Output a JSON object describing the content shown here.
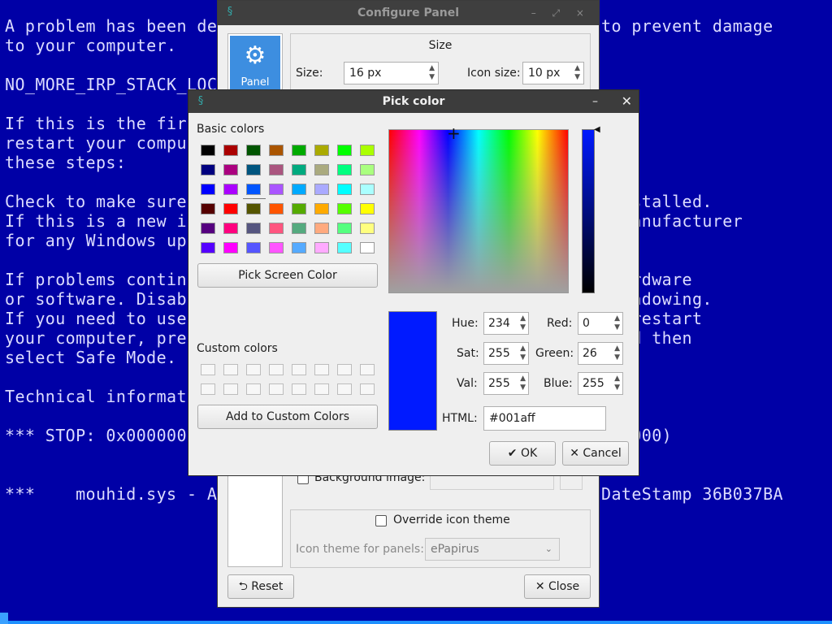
{
  "bsod": {
    "text": "A problem has been detected and Windows has been shut down to prevent damage\nto your computer.\n\nNO_MORE_IRP_STACK_LOCATIONS\n\nIf this is the first time you've seen this stop error screen,\nrestart your computer. If this screen appears again, follow\nthese steps:\n\nCheck to make sure any new hardware or software is properly installed.\nIf this is a new installation, ask your hardware or software manufacturer\nfor any Windows updates you might need.\n\nIf problems continue, disable or remove any newly installed hardware\nor software. Disable BIOS memory options such as caching or shadowing.\nIf you need to use Safe Mode to remove or disable components, restart\nyour computer, press F8 to select Advanced Startup Options, and then\nselect Safe Mode.\n\nTechnical information:\n\n*** STOP: 0x00000035 (0x00000000,0x00000000,0x00000000,0x00000000)\n\n\n***    mouhid.sys - Address 0xF84A6000 base at 0xF84A4000, DateStamp 36B037BA"
  },
  "config_panel": {
    "title": "Configure Panel",
    "side_item_label": "Panel",
    "size_group_title": "Size",
    "size_label": "Size:",
    "size_value": "16 px",
    "icon_size_label": "Icon size:",
    "icon_size_value": "10 px",
    "background_image_label": "Background image:",
    "override_icon_theme_label": "Override icon theme",
    "icon_theme_label": "Icon theme for panels:",
    "icon_theme_value": "ePapirus",
    "reset_label": "Reset",
    "close_label": "Close"
  },
  "pick_color": {
    "title": "Pick color",
    "basic_colors_label": "Basic colors",
    "basic_colors": [
      "#000000",
      "#aa0000",
      "#005500",
      "#aa5500",
      "#00aa00",
      "#aaaa00",
      "#00ff00",
      "#aaff00",
      "#00007f",
      "#aa007f",
      "#00557f",
      "#aa557f",
      "#00aa7f",
      "#aaaa7f",
      "#00ff7f",
      "#aaff7f",
      "#0000ff",
      "#aa00ff",
      "#0055ff",
      "#aa55ff",
      "#00aaff",
      "#aaaaff",
      "#00ffff",
      "#aaffff",
      "#550000",
      "#ff0000",
      "#555500",
      "#ff5500",
      "#55aa00",
      "#ffaa00",
      "#55ff00",
      "#ffff00",
      "#55007f",
      "#ff007f",
      "#55557f",
      "#ff557f",
      "#55aa7f",
      "#ffaa7f",
      "#55ff7f",
      "#ffff7f",
      "#5500ff",
      "#ff00ff",
      "#5555ff",
      "#ff55ff",
      "#55aaff",
      "#ffaaff",
      "#55ffff",
      "#ffffff"
    ],
    "pick_screen_label": "Pick Screen Color",
    "custom_colors_label": "Custom colors",
    "add_custom_label": "Add to Custom Colors",
    "hue_label": "Hue:",
    "hue_value": "234",
    "sat_label": "Sat:",
    "sat_value": "255",
    "val_label": "Val:",
    "val_value": "255",
    "red_label": "Red:",
    "red_value": "0",
    "green_label": "Green:",
    "green_value": "26",
    "blue_label": "Blue:",
    "blue_value": "255",
    "html_label": "HTML:",
    "html_value": "#001aff",
    "current_color": "#001aff",
    "ok_label": "OK",
    "cancel_label": "Cancel"
  }
}
